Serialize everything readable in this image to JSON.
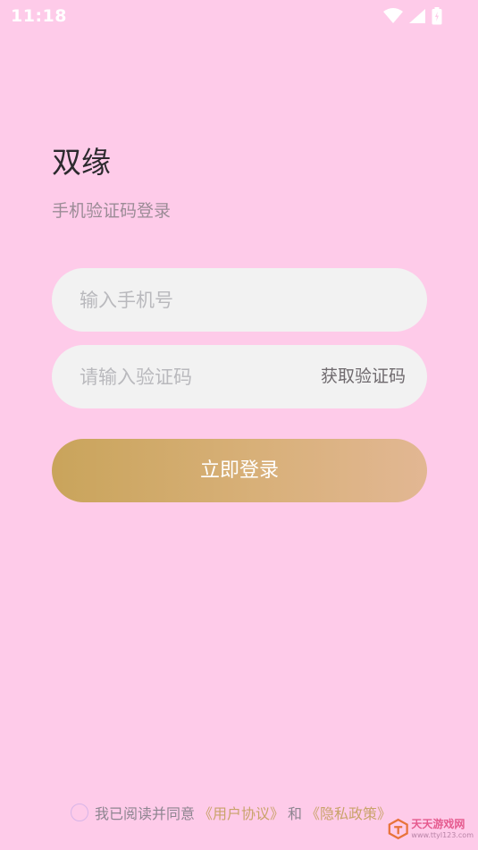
{
  "status_bar": {
    "time": "11:18",
    "icons": [
      "wifi-icon",
      "cellular-signal-icon",
      "battery-icon"
    ]
  },
  "header": {
    "title": "双缘",
    "subtitle": "手机验证码登录"
  },
  "form": {
    "phone_placeholder": "输入手机号",
    "phone_value": "",
    "code_placeholder": "请输入验证码",
    "code_value": "",
    "get_code_label": "获取验证码",
    "login_label": "立即登录"
  },
  "agreement": {
    "checked": false,
    "prefix": "我已阅读并同意",
    "user_agreement": "《用户协议》",
    "and": "和",
    "privacy_policy": "《隐私政策》"
  },
  "watermark": {
    "name": "天天游戏网",
    "url": "www.ttyl123.com"
  },
  "colors": {
    "background": "#fecbe9",
    "field_background": "#f2f2f2",
    "button_gradient_start": "#c9a45b",
    "button_gradient_end": "#e2b793",
    "link": "#c9a36a"
  }
}
